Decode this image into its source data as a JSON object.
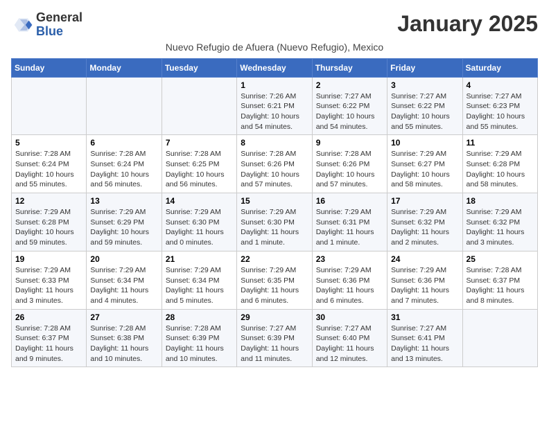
{
  "logo": {
    "general": "General",
    "blue": "Blue"
  },
  "title": "January 2025",
  "subtitle": "Nuevo Refugio de Afuera (Nuevo Refugio), Mexico",
  "days_of_week": [
    "Sunday",
    "Monday",
    "Tuesday",
    "Wednesday",
    "Thursday",
    "Friday",
    "Saturday"
  ],
  "weeks": [
    [
      {
        "day": "",
        "info": ""
      },
      {
        "day": "",
        "info": ""
      },
      {
        "day": "",
        "info": ""
      },
      {
        "day": "1",
        "info": "Sunrise: 7:26 AM\nSunset: 6:21 PM\nDaylight: 10 hours and 54 minutes."
      },
      {
        "day": "2",
        "info": "Sunrise: 7:27 AM\nSunset: 6:22 PM\nDaylight: 10 hours and 54 minutes."
      },
      {
        "day": "3",
        "info": "Sunrise: 7:27 AM\nSunset: 6:22 PM\nDaylight: 10 hours and 55 minutes."
      },
      {
        "day": "4",
        "info": "Sunrise: 7:27 AM\nSunset: 6:23 PM\nDaylight: 10 hours and 55 minutes."
      }
    ],
    [
      {
        "day": "5",
        "info": "Sunrise: 7:28 AM\nSunset: 6:24 PM\nDaylight: 10 hours and 55 minutes."
      },
      {
        "day": "6",
        "info": "Sunrise: 7:28 AM\nSunset: 6:24 PM\nDaylight: 10 hours and 56 minutes."
      },
      {
        "day": "7",
        "info": "Sunrise: 7:28 AM\nSunset: 6:25 PM\nDaylight: 10 hours and 56 minutes."
      },
      {
        "day": "8",
        "info": "Sunrise: 7:28 AM\nSunset: 6:26 PM\nDaylight: 10 hours and 57 minutes."
      },
      {
        "day": "9",
        "info": "Sunrise: 7:28 AM\nSunset: 6:26 PM\nDaylight: 10 hours and 57 minutes."
      },
      {
        "day": "10",
        "info": "Sunrise: 7:29 AM\nSunset: 6:27 PM\nDaylight: 10 hours and 58 minutes."
      },
      {
        "day": "11",
        "info": "Sunrise: 7:29 AM\nSunset: 6:28 PM\nDaylight: 10 hours and 58 minutes."
      }
    ],
    [
      {
        "day": "12",
        "info": "Sunrise: 7:29 AM\nSunset: 6:28 PM\nDaylight: 10 hours and 59 minutes."
      },
      {
        "day": "13",
        "info": "Sunrise: 7:29 AM\nSunset: 6:29 PM\nDaylight: 10 hours and 59 minutes."
      },
      {
        "day": "14",
        "info": "Sunrise: 7:29 AM\nSunset: 6:30 PM\nDaylight: 11 hours and 0 minutes."
      },
      {
        "day": "15",
        "info": "Sunrise: 7:29 AM\nSunset: 6:30 PM\nDaylight: 11 hours and 1 minute."
      },
      {
        "day": "16",
        "info": "Sunrise: 7:29 AM\nSunset: 6:31 PM\nDaylight: 11 hours and 1 minute."
      },
      {
        "day": "17",
        "info": "Sunrise: 7:29 AM\nSunset: 6:32 PM\nDaylight: 11 hours and 2 minutes."
      },
      {
        "day": "18",
        "info": "Sunrise: 7:29 AM\nSunset: 6:32 PM\nDaylight: 11 hours and 3 minutes."
      }
    ],
    [
      {
        "day": "19",
        "info": "Sunrise: 7:29 AM\nSunset: 6:33 PM\nDaylight: 11 hours and 3 minutes."
      },
      {
        "day": "20",
        "info": "Sunrise: 7:29 AM\nSunset: 6:34 PM\nDaylight: 11 hours and 4 minutes."
      },
      {
        "day": "21",
        "info": "Sunrise: 7:29 AM\nSunset: 6:34 PM\nDaylight: 11 hours and 5 minutes."
      },
      {
        "day": "22",
        "info": "Sunrise: 7:29 AM\nSunset: 6:35 PM\nDaylight: 11 hours and 6 minutes."
      },
      {
        "day": "23",
        "info": "Sunrise: 7:29 AM\nSunset: 6:36 PM\nDaylight: 11 hours and 6 minutes."
      },
      {
        "day": "24",
        "info": "Sunrise: 7:29 AM\nSunset: 6:36 PM\nDaylight: 11 hours and 7 minutes."
      },
      {
        "day": "25",
        "info": "Sunrise: 7:28 AM\nSunset: 6:37 PM\nDaylight: 11 hours and 8 minutes."
      }
    ],
    [
      {
        "day": "26",
        "info": "Sunrise: 7:28 AM\nSunset: 6:37 PM\nDaylight: 11 hours and 9 minutes."
      },
      {
        "day": "27",
        "info": "Sunrise: 7:28 AM\nSunset: 6:38 PM\nDaylight: 11 hours and 10 minutes."
      },
      {
        "day": "28",
        "info": "Sunrise: 7:28 AM\nSunset: 6:39 PM\nDaylight: 11 hours and 10 minutes."
      },
      {
        "day": "29",
        "info": "Sunrise: 7:27 AM\nSunset: 6:39 PM\nDaylight: 11 hours and 11 minutes."
      },
      {
        "day": "30",
        "info": "Sunrise: 7:27 AM\nSunset: 6:40 PM\nDaylight: 11 hours and 12 minutes."
      },
      {
        "day": "31",
        "info": "Sunrise: 7:27 AM\nSunset: 6:41 PM\nDaylight: 11 hours and 13 minutes."
      },
      {
        "day": "",
        "info": ""
      }
    ]
  ]
}
